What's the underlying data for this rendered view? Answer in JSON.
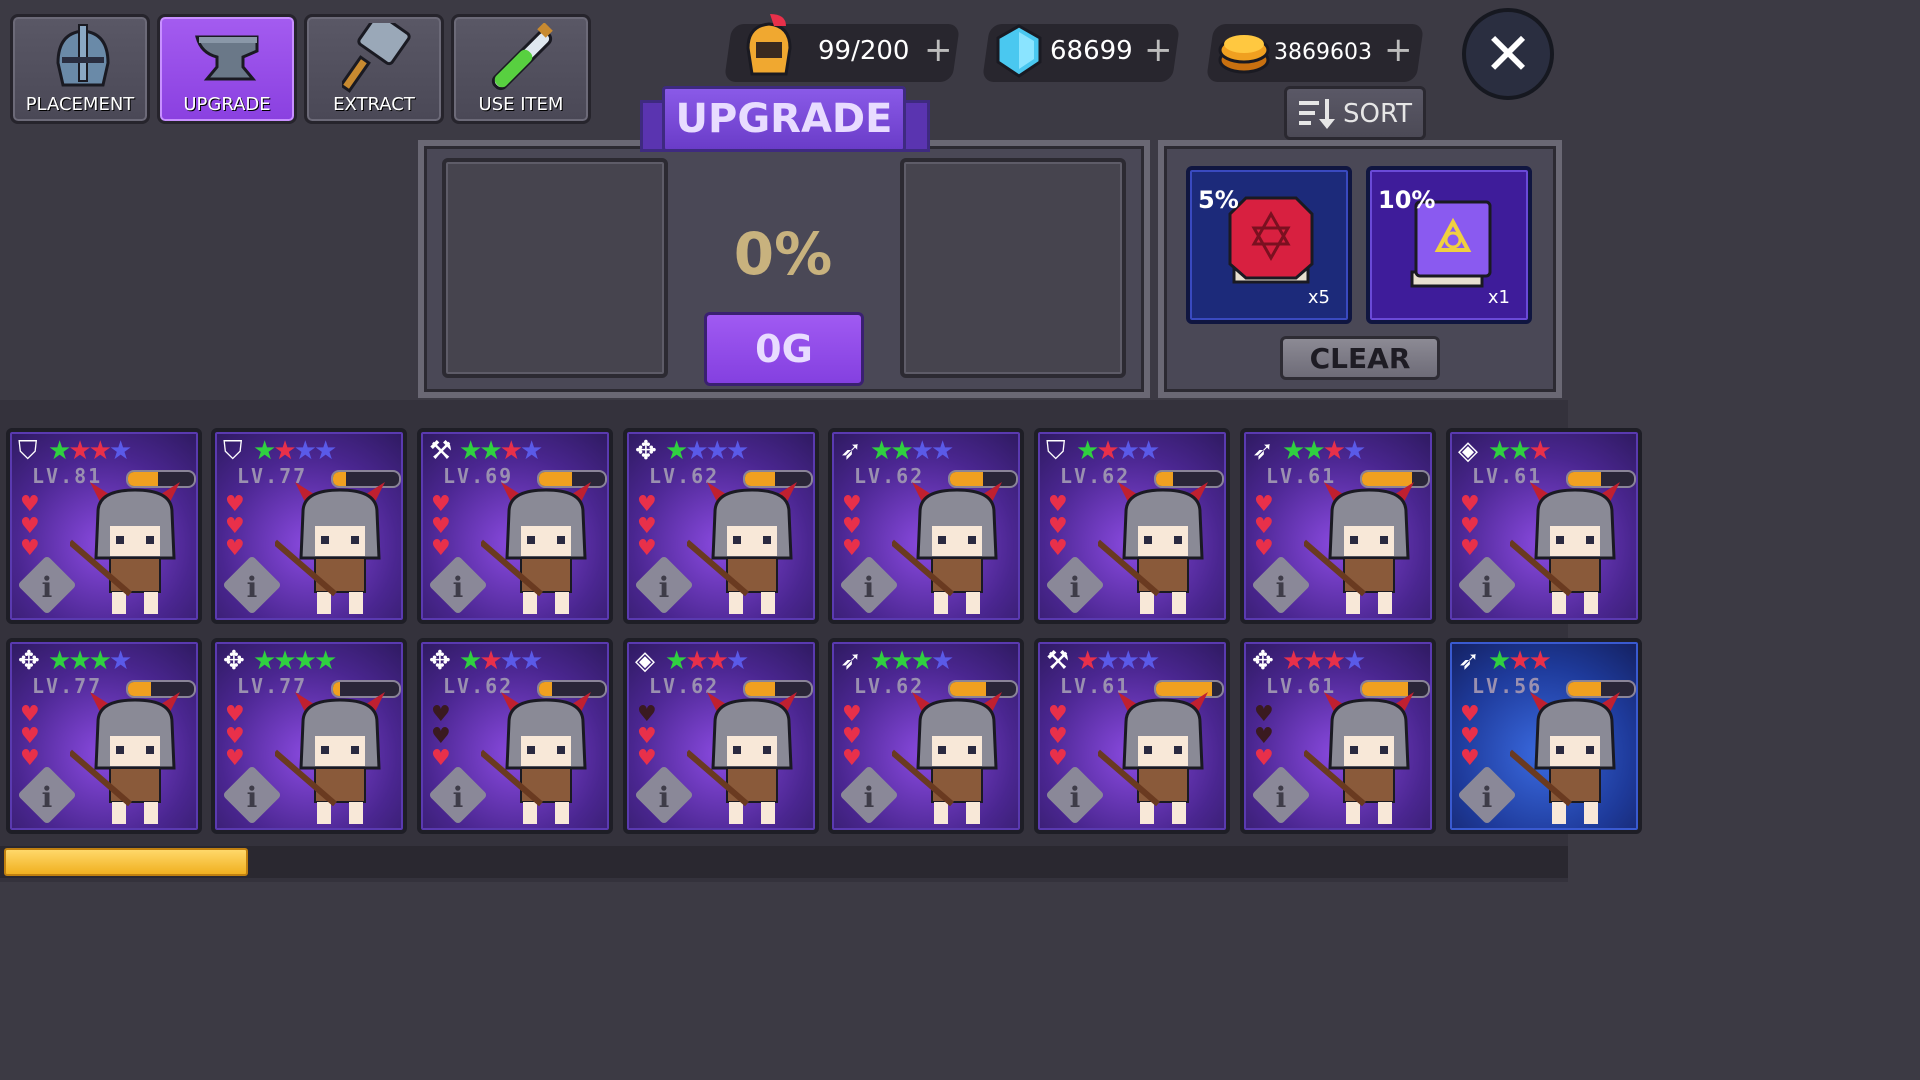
{
  "tabs": [
    {
      "label": "PLACEMENT",
      "icon": "helmet-icon",
      "active": false
    },
    {
      "label": "UPGRADE",
      "icon": "anvil-icon",
      "active": true
    },
    {
      "label": "EXTRACT",
      "icon": "hammer-icon",
      "active": false
    },
    {
      "label": "USE ITEM",
      "icon": "potion-icon",
      "active": false
    }
  ],
  "currencies": {
    "units": {
      "value": "99/200",
      "plus": "+",
      "icon": "knight-helmet-icon"
    },
    "gems": {
      "value": "68699",
      "plus": "+",
      "icon": "diamond-icon"
    },
    "gold": {
      "value": "3869603",
      "plus": "+",
      "icon": "gold-coin-icon"
    }
  },
  "close": {
    "glyph": "✕"
  },
  "sort": {
    "label": "SORT",
    "icon": "sort-icon"
  },
  "upgrade": {
    "title": "UPGRADE",
    "percent": "0%",
    "cost": "0G"
  },
  "books": [
    {
      "percent": "5%",
      "qty": "x5",
      "color": "#d82040"
    },
    {
      "percent": "10%",
      "qty": "x1",
      "color": "#6a3cd8"
    }
  ],
  "clear": {
    "label": "CLEAR"
  },
  "colors": {
    "accent_purple": "#9a50f0",
    "star_green": "#30d040",
    "star_red": "#e8304a",
    "star_blue": "#5a5ae8",
    "progress_orange": "#f0a020"
  },
  "units_grid": [
    [
      {
        "cls": "⛉",
        "class_icon": "shield-icon",
        "stars": [
          "g",
          "r",
          "r",
          "b"
        ],
        "level": "LV.81",
        "xp": 0.45,
        "hearts": 3
      },
      {
        "cls": "⛉",
        "class_icon": "shield-icon",
        "stars": [
          "g",
          "r",
          "b",
          "b"
        ],
        "level": "LV.77",
        "xp": 0.2,
        "hearts": 3
      },
      {
        "cls": "⚒",
        "class_icon": "axe-icon",
        "stars": [
          "g",
          "g",
          "r",
          "b"
        ],
        "level": "LV.69",
        "xp": 0.5,
        "hearts": 3
      },
      {
        "cls": "✥",
        "class_icon": "cross-icon",
        "stars": [
          "g",
          "b",
          "b",
          "b"
        ],
        "level": "LV.62",
        "xp": 0.45,
        "hearts": 3
      },
      {
        "cls": "➶",
        "class_icon": "bow-icon",
        "stars": [
          "g",
          "g",
          "b",
          "b"
        ],
        "level": "LV.62",
        "xp": 0.5,
        "hearts": 3
      },
      {
        "cls": "⛉",
        "class_icon": "shield-icon",
        "stars": [
          "g",
          "r",
          "b",
          "b"
        ],
        "level": "LV.62",
        "xp": 0.25,
        "hearts": 3
      },
      {
        "cls": "➶",
        "class_icon": "bow-icon",
        "stars": [
          "g",
          "g",
          "r",
          "b"
        ],
        "level": "LV.61",
        "xp": 0.75,
        "hearts": 3
      },
      {
        "cls": "◈",
        "class_icon": "diamond-class-icon",
        "stars": [
          "g",
          "g",
          "r"
        ],
        "level": "LV.61",
        "xp": 0.5,
        "hearts": 3
      }
    ],
    [
      {
        "cls": "✥",
        "class_icon": "cross-icon",
        "stars": [
          "g",
          "g",
          "g",
          "b"
        ],
        "level": "LV.77",
        "xp": 0.35,
        "hearts": 3
      },
      {
        "cls": "✥",
        "class_icon": "cross-icon",
        "stars": [
          "g",
          "g",
          "g",
          "g"
        ],
        "level": "LV.77",
        "xp": 0.1,
        "hearts": 3
      },
      {
        "cls": "✥",
        "class_icon": "cross-icon",
        "stars": [
          "g",
          "r",
          "b",
          "b"
        ],
        "level": "LV.62",
        "xp": 0.2,
        "hearts": 1
      },
      {
        "cls": "◈",
        "class_icon": "diamond-class-icon",
        "stars": [
          "g",
          "r",
          "r",
          "b"
        ],
        "level": "LV.62",
        "xp": 0.45,
        "hearts": 2
      },
      {
        "cls": "➶",
        "class_icon": "bow-icon",
        "stars": [
          "g",
          "g",
          "g",
          "b"
        ],
        "level": "LV.62",
        "xp": 0.55,
        "hearts": 3
      },
      {
        "cls": "⚒",
        "class_icon": "axe-icon",
        "stars": [
          "r",
          "b",
          "b",
          "b"
        ],
        "level": "LV.61",
        "xp": 0.85,
        "hearts": 3
      },
      {
        "cls": "✥",
        "class_icon": "cross-icon",
        "stars": [
          "r",
          "r",
          "r",
          "b"
        ],
        "level": "LV.61",
        "xp": 0.7,
        "hearts": 1
      },
      {
        "cls": "➶",
        "class_icon": "bow-icon",
        "stars": [
          "g",
          "r",
          "r"
        ],
        "level": "LV.56",
        "xp": 0.5,
        "hearts": 3,
        "blue": true
      }
    ]
  ],
  "scroll": {
    "position": 0.0
  }
}
